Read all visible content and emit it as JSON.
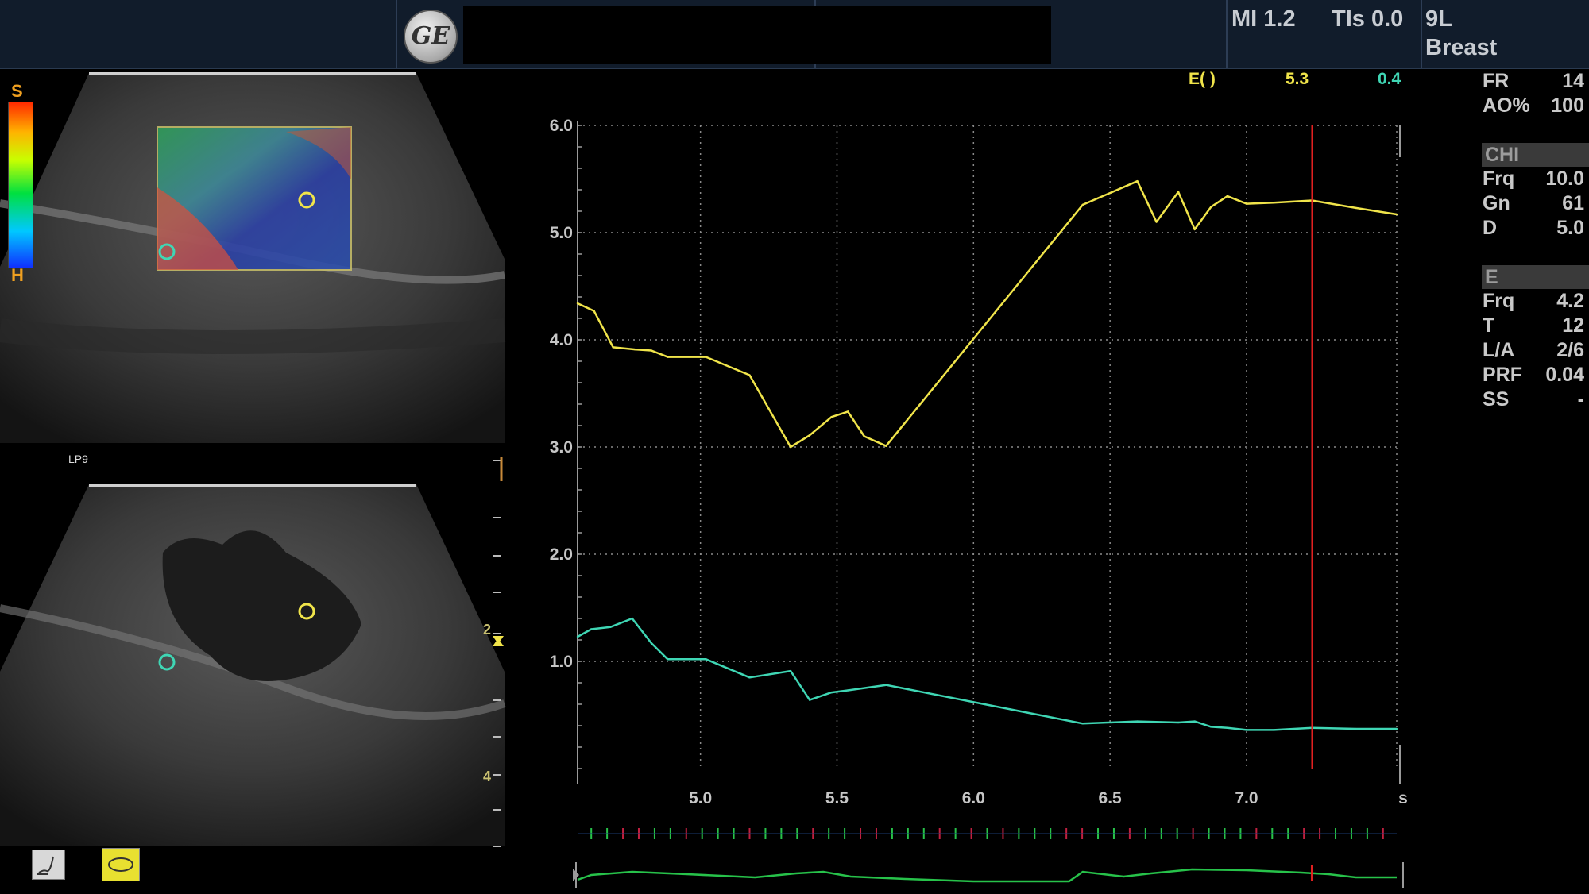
{
  "header": {
    "logo_text": "GE",
    "mi": "MI 1.2",
    "tis": "TIs 0.0",
    "probe": "9L",
    "preset": "Breast"
  },
  "images": {
    "probe_label": "LP9",
    "scale_top": "S",
    "scale_bottom": "H",
    "depth_marks": [
      "2",
      "4"
    ]
  },
  "params": {
    "fr_label": "FR",
    "fr_value": "14",
    "ao_label": "AO%",
    "ao_value": "100",
    "chi_title": "CHI",
    "chi": [
      {
        "label": "Frq",
        "value": "10.0"
      },
      {
        "label": "Gn",
        "value": "61"
      },
      {
        "label": "D",
        "value": "5.0"
      }
    ],
    "e_title": "E",
    "e": [
      {
        "label": "Frq",
        "value": "4.2"
      },
      {
        "label": "T",
        "value": "12"
      },
      {
        "label": "L/A",
        "value": "2/6"
      },
      {
        "label": "PRF",
        "value": "0.04"
      },
      {
        "label": "SS",
        "value": "-"
      }
    ]
  },
  "legend": {
    "label": "E( )",
    "yellow_value": "5.3",
    "teal_value": "0.4"
  },
  "colors": {
    "yellow": "#f0e44a",
    "teal": "#3fd6b4",
    "cursor": "#e02020",
    "ecg": "#27c24a"
  },
  "chart_data": {
    "type": "line",
    "xlabel": "s",
    "ylabel": "",
    "xlim": [
      4.55,
      7.55
    ],
    "ylim": [
      0.0,
      6.0
    ],
    "x_ticks": [
      5.0,
      5.5,
      6.0,
      6.5,
      7.0
    ],
    "x_tick_labels": [
      "5.0",
      "5.5",
      "6.0",
      "6.5",
      "7.0"
    ],
    "y_ticks": [
      1.0,
      2.0,
      3.0,
      4.0,
      5.0,
      6.0
    ],
    "y_tick_labels": [
      "1.0",
      "2.0",
      "3.0",
      "4.0",
      "5.0",
      "6.0"
    ],
    "grid": true,
    "cursor_x": 7.24,
    "series": [
      {
        "color": "#f0e44a",
        "x": [
          4.55,
          4.61,
          4.68,
          4.76,
          4.82,
          4.88,
          5.02,
          5.18,
          5.33,
          5.4,
          5.48,
          5.54,
          5.6,
          5.68,
          6.4,
          6.6,
          6.67,
          6.75,
          6.81,
          6.87,
          6.93,
          7.0,
          7.1,
          7.24,
          7.4,
          7.55
        ],
        "y": [
          4.34,
          4.27,
          3.93,
          3.91,
          3.9,
          3.84,
          3.84,
          3.67,
          3.0,
          3.11,
          3.28,
          3.33,
          3.1,
          3.01,
          5.26,
          5.48,
          5.1,
          5.38,
          5.03,
          5.24,
          5.34,
          5.27,
          5.28,
          5.3,
          5.23,
          5.17
        ]
      },
      {
        "color": "#3fd6b4",
        "x": [
          4.55,
          4.6,
          4.67,
          4.75,
          4.82,
          4.88,
          5.02,
          5.18,
          5.33,
          5.4,
          5.48,
          5.54,
          5.68,
          6.4,
          6.6,
          6.75,
          6.81,
          6.87,
          6.93,
          7.0,
          7.1,
          7.24,
          7.4,
          7.55
        ],
        "y": [
          1.23,
          1.3,
          1.32,
          1.4,
          1.17,
          1.02,
          1.02,
          0.85,
          0.91,
          0.64,
          0.71,
          0.73,
          0.78,
          0.42,
          0.44,
          0.43,
          0.44,
          0.39,
          0.38,
          0.36,
          0.36,
          0.38,
          0.37,
          0.37
        ]
      }
    ]
  }
}
